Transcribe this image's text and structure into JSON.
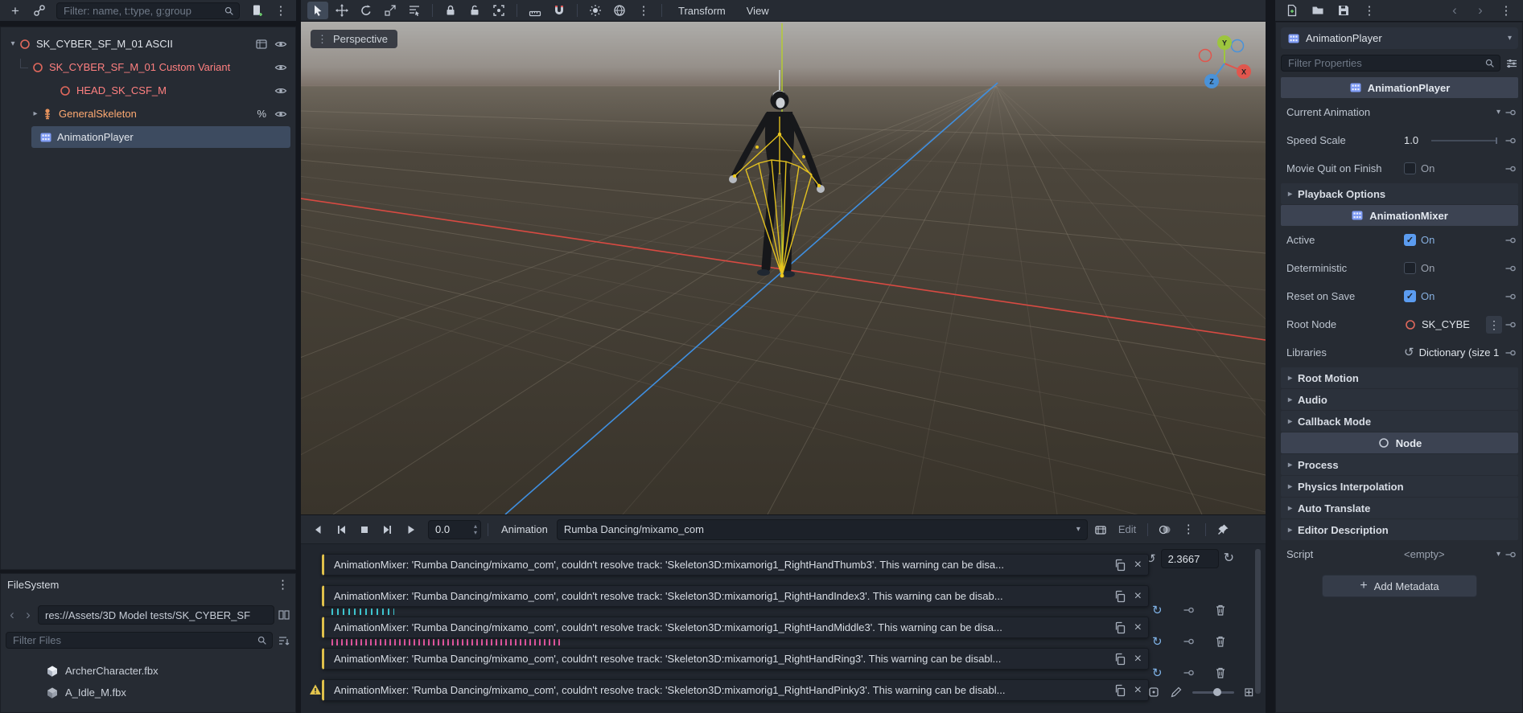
{
  "icons": {
    "dots_vertical": "⋮",
    "caret_down": "▾",
    "collapse_open": "▾",
    "collapse_closed": "▸",
    "undo": "↺",
    "loop": "↻",
    "spin_up": "▴",
    "spin_down": "▾",
    "chevron_left": "‹",
    "chevron_right": "›",
    "close": "×",
    "plus": "+",
    "check": "✓",
    "expand": "⊞",
    "percent": "%"
  },
  "colors": {
    "accent": "#5b9cf0",
    "warning_yellow": "#dfc04b",
    "axis_x_red": "#e0564d",
    "axis_y_green": "#9dc53e",
    "axis_z_blue": "#4a92d8"
  },
  "scene_dock": {
    "filter_placeholder": "Filter: name, t:type, g:group",
    "rows": [
      {
        "label": "SK_CYBER_SF_M_01 ASCII"
      },
      {
        "label": "SK_CYBER_SF_M_01 Custom Variant"
      },
      {
        "label": "HEAD_SK_CSF_M"
      },
      {
        "label": "GeneralSkeleton"
      },
      {
        "label": "AnimationPlayer"
      }
    ]
  },
  "viewport": {
    "transform_menu": "Transform",
    "view_menu": "View",
    "perspective_label": "Perspective",
    "axis_labels": {
      "x": "X",
      "y": "Y",
      "z": "Z"
    }
  },
  "filesystem": {
    "title": "FileSystem",
    "path": "res://Assets/3D Model tests/SK_CYBER_SF",
    "filter_placeholder": "Filter Files",
    "files": [
      {
        "name": "ArcherCharacter.fbx"
      },
      {
        "name": "A_Idle_M.fbx"
      }
    ]
  },
  "anim": {
    "time_value": "0.0",
    "animation_label": "Animation",
    "animation_name": "Rumba Dancing/mixamo_com",
    "edit_label": "Edit",
    "length_value": "2.3667",
    "warnings": [
      "AnimationMixer: 'Rumba Dancing/mixamo_com',  couldn't resolve track:  'Skeleton3D:mixamorig1_RightHandThumb3'. This warning can be disa...",
      "AnimationMixer: 'Rumba Dancing/mixamo_com',  couldn't resolve track:  'Skeleton3D:mixamorig1_RightHandIndex3'. This warning can be disab...",
      "AnimationMixer: 'Rumba Dancing/mixamo_com',  couldn't resolve track:  'Skeleton3D:mixamorig1_RightHandMiddle3'. This warning can be disa...",
      "AnimationMixer: 'Rumba Dancing/mixamo_com',  couldn't resolve track:  'Skeleton3D:mixamorig1_RightHandRing3'. This warning can be disabl...",
      "AnimationMixer: 'Rumba Dancing/mixamo_com',  couldn't resolve track:  'Skeleton3D:mixamorig1_RightHandPinky3'. This warning can be disabl..."
    ]
  },
  "inspector": {
    "selected_node": "AnimationPlayer",
    "filter_placeholder": "Filter Properties",
    "categories": {
      "player": "AnimationPlayer",
      "mixer": "AnimationMixer",
      "node": "Node"
    },
    "props": {
      "current_animation": {
        "label": "Current Animation",
        "value": ""
      },
      "speed_scale": {
        "label": "Speed Scale",
        "value": "1.0"
      },
      "movie_quit": {
        "label": "Movie Quit on Finish",
        "value": "On"
      },
      "playback_options": {
        "label": "Playback Options"
      },
      "active": {
        "label": "Active",
        "value": "On"
      },
      "deterministic": {
        "label": "Deterministic",
        "value": "On"
      },
      "reset_on_save": {
        "label": "Reset on Save",
        "value": "On"
      },
      "root_node": {
        "label": "Root Node",
        "value": "SK_CYBE"
      },
      "libraries": {
        "label": "Libraries",
        "value": "Dictionary (size 1"
      },
      "root_motion": {
        "label": "Root Motion"
      },
      "audio": {
        "label": "Audio"
      },
      "callback_mode": {
        "label": "Callback Mode"
      },
      "process": {
        "label": "Process"
      },
      "physics_interpolation": {
        "label": "Physics Interpolation"
      },
      "auto_translate": {
        "label": "Auto Translate"
      },
      "editor_description": {
        "label": "Editor Description"
      },
      "script": {
        "label": "Script",
        "value": "<empty>"
      }
    },
    "add_metadata_label": "Add Metadata"
  }
}
